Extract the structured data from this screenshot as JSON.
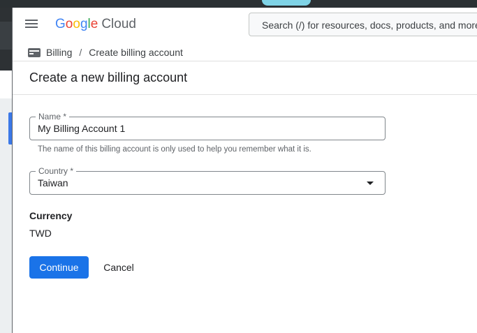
{
  "header": {
    "logo_google_letters": [
      "G",
      "o",
      "o",
      "g",
      "l",
      "e"
    ],
    "logo_product": "Cloud",
    "search_placeholder": "Search (/) for resources, docs, products, and more"
  },
  "breadcrumb": {
    "icon": "billing-card-icon",
    "parent": "Billing",
    "separator": "/",
    "current": "Create billing account"
  },
  "page": {
    "title": "Create a new billing account"
  },
  "form": {
    "name_label": "Name *",
    "name_value": "My Billing Account 1",
    "name_hint": "The name of this billing account is only used to help you remember what it is.",
    "country_label": "Country *",
    "country_value": "Taiwan",
    "currency_label": "Currency",
    "currency_value": "TWD"
  },
  "actions": {
    "continue_label": "Continue",
    "cancel_label": "Cancel"
  },
  "colors": {
    "primary": "#1a73e8",
    "text": "#202124",
    "secondary_text": "#5f6368"
  }
}
